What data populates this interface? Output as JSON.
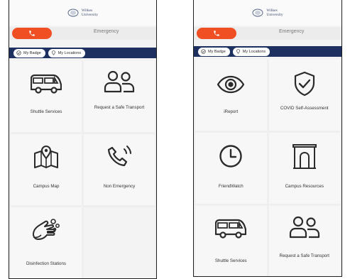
{
  "logo_text": [
    "Wilkes",
    "University"
  ],
  "tabs": {
    "emergency": "Emergency"
  },
  "pills": {
    "badge": "My Badge",
    "locations": "My Locations"
  },
  "left": {
    "tiles": [
      {
        "label": "Shuttle Services",
        "icon": "bus-icon"
      },
      {
        "label": "Request a Safe Transport",
        "icon": "people-icon"
      },
      {
        "label": "Campus Map",
        "icon": "map-pin-icon"
      },
      {
        "label": "Non Emergency",
        "icon": "phone-call-icon"
      },
      {
        "label": "Disinfection Stations",
        "icon": "hand-wash-icon"
      }
    ]
  },
  "right": {
    "tiles": [
      {
        "label": "iReport",
        "icon": "eye-icon"
      },
      {
        "label": "COVID Self-Assessment",
        "icon": "shield-check-icon"
      },
      {
        "label": "FriendWatch",
        "icon": "clock-icon"
      },
      {
        "label": "Campus Resources",
        "icon": "archway-icon"
      },
      {
        "label": "Shuttle Services",
        "icon": "bus-icon"
      },
      {
        "label": "Request a Safe Transport",
        "icon": "people-icon"
      }
    ]
  },
  "colors": {
    "accent": "#f04e23",
    "navy": "#1e3060",
    "icon": "#2b2b2b"
  }
}
